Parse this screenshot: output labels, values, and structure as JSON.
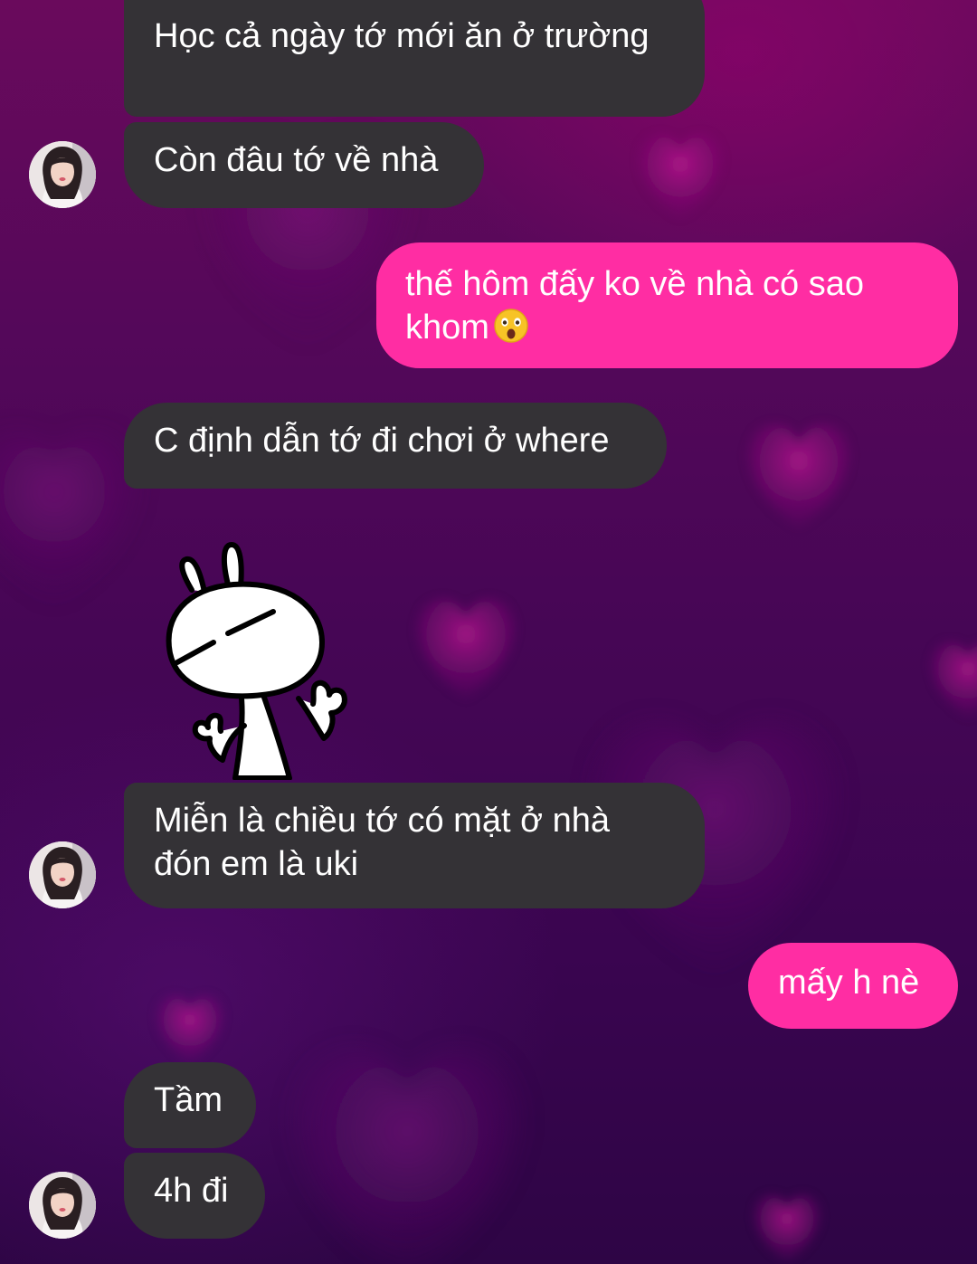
{
  "theme": {
    "incoming_bubble_color": "#343236",
    "outgoing_bubble_color": "#ff2da3",
    "background_color": "#4a0656",
    "heart_color": "#c0188e"
  },
  "messages": [
    {
      "id": "m1",
      "side": "incoming",
      "text": "Học cả ngày tớ mới ăn ở trường"
    },
    {
      "id": "m2",
      "side": "incoming",
      "text": "Còn đâu tớ về nhà"
    },
    {
      "id": "m3",
      "side": "outgoing",
      "text": "thế hôm đấy ko về nhà có sao khom",
      "emoji": "astonished-face-icon"
    },
    {
      "id": "m4",
      "side": "incoming",
      "text": "C định dẫn tớ đi chơi ở where"
    },
    {
      "id": "m5",
      "side": "incoming",
      "type": "sticker",
      "sticker": "rabbit-shrug-sticker"
    },
    {
      "id": "m6",
      "side": "incoming",
      "text": "Miễn là chiều tớ có mặt ở nhà đón em là uki"
    },
    {
      "id": "m7",
      "side": "outgoing",
      "text": "mấy h nè"
    },
    {
      "id": "m8",
      "side": "incoming",
      "text": "Tầm"
    },
    {
      "id": "m9",
      "side": "incoming",
      "text": "4h đi"
    }
  ],
  "contact": {
    "avatar_icon": "contact-avatar"
  }
}
